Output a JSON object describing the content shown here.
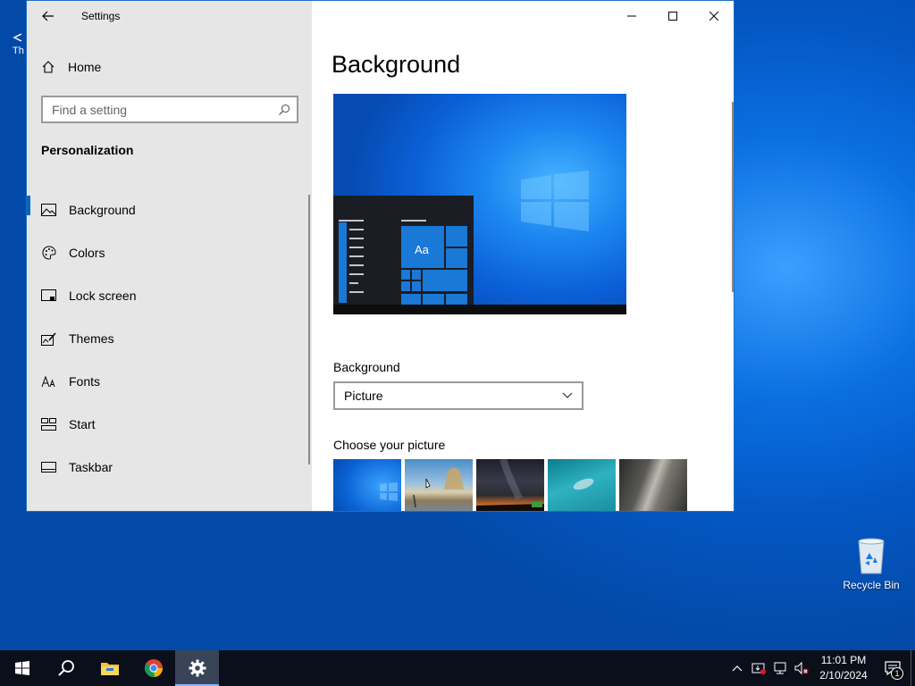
{
  "window": {
    "app_title": "Settings",
    "home_label": "Home",
    "search_placeholder": "Find a setting",
    "section_title": "Personalization",
    "nav_items": [
      {
        "label": "Background",
        "icon": "picture-icon",
        "active": true
      },
      {
        "label": "Colors",
        "icon": "palette-icon"
      },
      {
        "label": "Lock screen",
        "icon": "lock-screen-icon"
      },
      {
        "label": "Themes",
        "icon": "themes-icon"
      },
      {
        "label": "Fonts",
        "icon": "fonts-icon"
      },
      {
        "label": "Start",
        "icon": "start-icon"
      },
      {
        "label": "Taskbar",
        "icon": "taskbar-icon"
      }
    ]
  },
  "content": {
    "page_title": "Background",
    "preview_sample_text": "Aa",
    "background_label": "Background",
    "background_value": "Picture",
    "choose_label": "Choose your picture"
  },
  "desktop": {
    "recycle_bin_label": "Recycle Bin",
    "partial_icon_text": "Th"
  },
  "taskbar": {
    "apps": [
      "start-icon",
      "search-icon",
      "file-explorer-icon",
      "chrome-icon",
      "settings-icon"
    ],
    "active_app": "settings-icon",
    "clock_time": "11:01 PM",
    "clock_date": "2/10/2024",
    "notification_count": "1"
  },
  "colors": {
    "accent": "#0067c0",
    "sidebar_bg": "#e6e6e6",
    "taskbar_bg": "#0a0f1a"
  }
}
